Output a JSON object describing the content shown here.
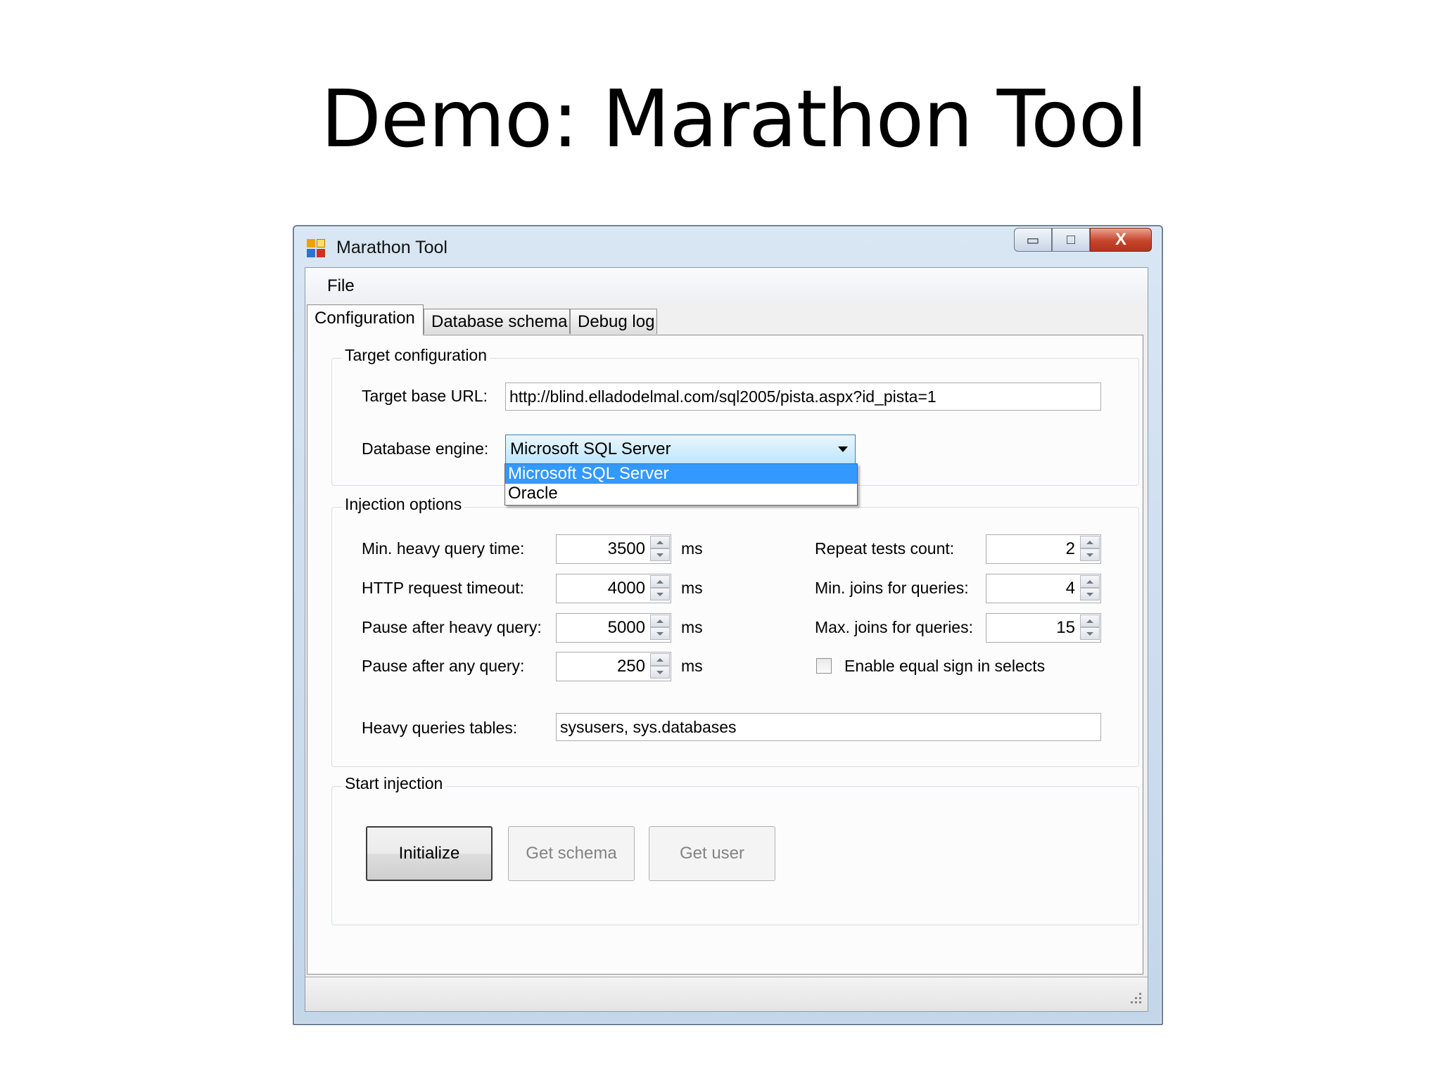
{
  "slide": {
    "title": "Demo: Marathon Tool"
  },
  "window": {
    "title": "Marathon Tool",
    "buttons": {
      "minimize": "▭",
      "maximize": "□",
      "close": "X"
    }
  },
  "menu": {
    "file": "File"
  },
  "tabs": [
    {
      "label": "Configuration",
      "active": true
    },
    {
      "label": "Database schema",
      "active": false
    },
    {
      "label": "Debug log",
      "active": false
    }
  ],
  "target_config": {
    "group_label": "Target configuration",
    "url_label": "Target base URL:",
    "url_value": "http://blind.elladodelmal.com/sql2005/pista.aspx?id_pista=1",
    "engine_label": "Database engine:",
    "engine_value": "Microsoft SQL Server",
    "engine_options": [
      "Microsoft SQL Server",
      "Oracle"
    ],
    "engine_selected_index": 0
  },
  "injection": {
    "group_label": "Injection options",
    "left": [
      {
        "label": "Min. heavy query time:",
        "value": "3500",
        "unit": "ms"
      },
      {
        "label": "HTTP request timeout:",
        "value": "4000",
        "unit": "ms"
      },
      {
        "label": "Pause after heavy query:",
        "value": "5000",
        "unit": "ms"
      },
      {
        "label": "Pause after any query:",
        "value": "250",
        "unit": "ms"
      }
    ],
    "right": [
      {
        "label": "Repeat tests count:",
        "value": "2"
      },
      {
        "label": "Min. joins for queries:",
        "value": "4"
      },
      {
        "label": "Max. joins for queries:",
        "value": "15"
      }
    ],
    "equal_sign_label": "Enable equal sign in selects",
    "equal_sign_checked": false,
    "heavy_tables_label": "Heavy queries tables:",
    "heavy_tables_value": "sysusers, sys.databases"
  },
  "start": {
    "group_label": "Start injection",
    "initialize": "Initialize",
    "get_schema": "Get schema",
    "get_user": "Get user"
  },
  "colors": {
    "selection": "#3399ff",
    "close_button": "#c5452a"
  }
}
